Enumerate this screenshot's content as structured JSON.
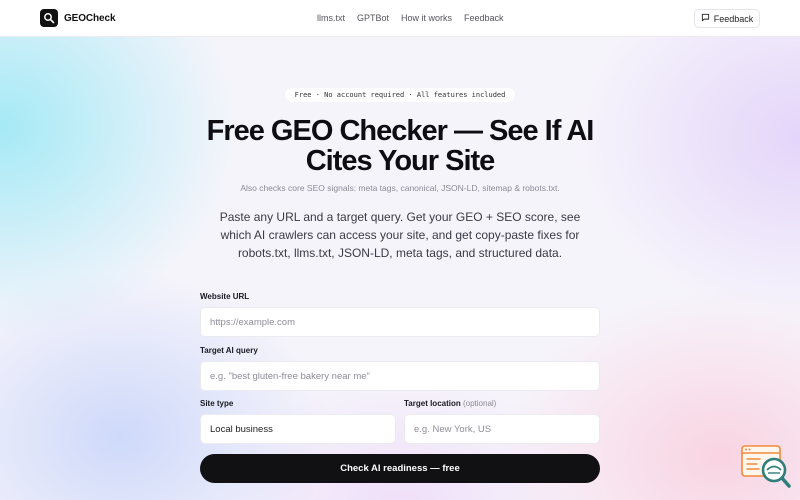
{
  "header": {
    "brand": "GEOCheck",
    "nav": [
      {
        "label": "llms.txt"
      },
      {
        "label": "GPTBot"
      },
      {
        "label": "How it works"
      },
      {
        "label": "Feedback"
      }
    ],
    "feedback_button": "Feedback"
  },
  "hero": {
    "badge": "Free · No account required · All features included",
    "title": "Free GEO Checker — See If AI Cites Your Site",
    "seo_note": "Also checks core SEO signals: meta tags, canonical, JSON-LD, sitemap & robots.txt.",
    "lead": "Paste any URL and a target query. Get your GEO + SEO score, see which AI crawlers can access your site, and get copy-paste fixes for robots.txt, llms.txt, JSON-LD, meta tags, and structured data."
  },
  "form": {
    "website_url": {
      "label": "Website URL",
      "placeholder": "https://example.com",
      "value": ""
    },
    "target_query": {
      "label": "Target AI query",
      "placeholder": "e.g. \"best gluten-free bakery near me\"",
      "value": ""
    },
    "site_type": {
      "label": "Site type",
      "value": "Local business"
    },
    "target_location": {
      "label": "Target location",
      "optional": "(optional)",
      "placeholder": "e.g. New York, US",
      "value": ""
    },
    "submit": "Check AI readiness — free"
  },
  "icons": {
    "brand_logo": "search-icon",
    "feedback": "message-square-icon",
    "widget": "browser-search-icon"
  },
  "colors": {
    "primary": "#111114",
    "widget_accent": "#f08a3c",
    "widget_teal": "#2f7e7b"
  }
}
